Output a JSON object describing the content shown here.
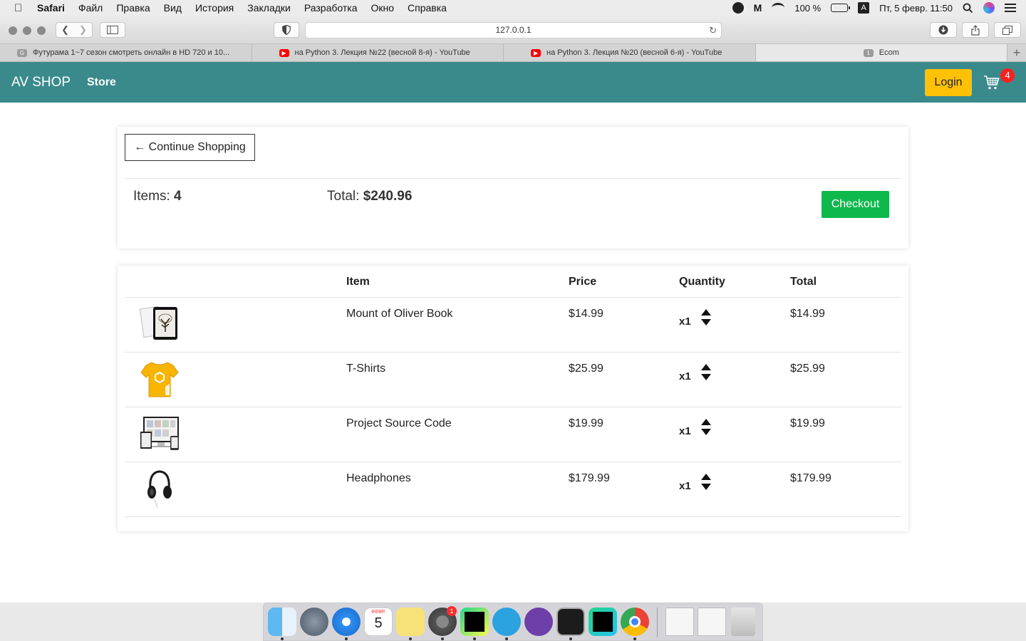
{
  "menubar": {
    "app": "Safari",
    "items": [
      "Файл",
      "Правка",
      "Вид",
      "История",
      "Закладки",
      "Разработка",
      "Окно",
      "Справка"
    ],
    "battery": "100 %",
    "input_source": "A",
    "datetime": "Пт, 5 февр. 11:50"
  },
  "browser": {
    "url": "127.0.0.1",
    "tabs": [
      {
        "title": "Футурама 1~7 сезон смотреть онлайн в HD 720 и 10...",
        "favicon": "G"
      },
      {
        "title": "на Python 3. Лекция №22 (весной 8-я) - YouTube",
        "favicon": ""
      },
      {
        "title": "на Python 3. Лекция №20 (весной 6-я) - YouTube",
        "favicon": ""
      },
      {
        "title": "Ecom",
        "favicon": "1"
      }
    ],
    "new_tab": "+"
  },
  "navbar": {
    "brand": "AV SHOP",
    "store": "Store",
    "login": "Login",
    "cart_count": "4"
  },
  "summary": {
    "continue_label": "← Continue Shopping",
    "items_label": "Items:",
    "items_value": "4",
    "total_label": "Total:",
    "total_value": "$240.96",
    "checkout_label": "Checkout"
  },
  "table": {
    "headers": {
      "item": "Item",
      "price": "Price",
      "quantity": "Quantity",
      "total": "Total"
    },
    "rows": [
      {
        "name": "Mount of Oliver Book",
        "price": "$14.99",
        "qty": "x1",
        "total": "$14.99",
        "image": "book-tablet"
      },
      {
        "name": "T-Shirts",
        "price": "$25.99",
        "qty": "x1",
        "total": "$25.99",
        "image": "yellow-tshirt"
      },
      {
        "name": "Project Source Code",
        "price": "$19.99",
        "qty": "x1",
        "total": "$19.99",
        "image": "devices-screens"
      },
      {
        "name": "Headphones",
        "price": "$179.99",
        "qty": "x1",
        "total": "$179.99",
        "image": "black-headphones"
      }
    ]
  },
  "dock": {
    "calendar_month": "ФЕВР.",
    "calendar_day": "5",
    "prefs_badge": "1",
    "apps": [
      "finder",
      "launchpad",
      "safari",
      "calendar",
      "stickies",
      "system-preferences",
      "pycharm",
      "telegram",
      "github-desktop",
      "terminal",
      "pycharm-ce",
      "chrome",
      "window-preview",
      "window-preview-2",
      "trash"
    ]
  },
  "colors": {
    "navbar": "#3a8a8c",
    "login": "#ffc107",
    "checkout": "#0fb84d",
    "badge": "#ff1f1f"
  }
}
